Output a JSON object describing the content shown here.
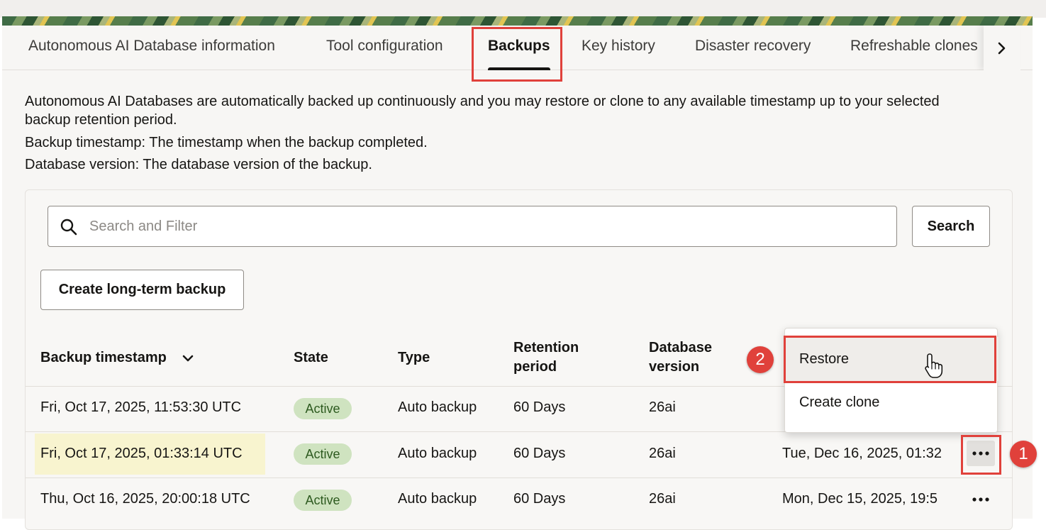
{
  "tabs": [
    {
      "label": "Autonomous AI Database information"
    },
    {
      "label": "Tool configuration"
    },
    {
      "label": "Backups"
    },
    {
      "label": "Key history"
    },
    {
      "label": "Disaster recovery"
    },
    {
      "label": "Refreshable clones"
    }
  ],
  "active_tab": "Backups",
  "description": {
    "line1": "Autonomous AI Databases are automatically backed up continuously and you may restore or clone to any available timestamp up to your selected",
    "line2": "backup retention period.",
    "line3": "Backup timestamp: The timestamp when the backup completed.",
    "line4": "Database version: The database version of the backup."
  },
  "search": {
    "placeholder": "Search and Filter",
    "value": "",
    "button_label": "Search"
  },
  "create_backup_label": "Create long-term backup",
  "table": {
    "headers": {
      "timestamp": "Backup timestamp",
      "state": "State",
      "type": "Type",
      "retention_1": "Retention",
      "retention_2": "period",
      "dbversion_1": "Database",
      "dbversion_2": "version"
    },
    "rows": [
      {
        "timestamp": "Fri, Oct 17, 2025, 11:53:30 UTC",
        "state": "Active",
        "type": "Auto backup",
        "retention": "60 Days",
        "version": "26ai",
        "expires": ""
      },
      {
        "timestamp": "Fri, Oct 17, 2025, 01:33:14 UTC",
        "state": "Active",
        "type": "Auto backup",
        "retention": "60 Days",
        "version": "26ai",
        "expires": "Tue, Dec 16, 2025, 01:32"
      },
      {
        "timestamp": "Thu, Oct 16, 2025, 20:00:18 UTC",
        "state": "Active",
        "type": "Auto backup",
        "retention": "60 Days",
        "version": "26ai",
        "expires": "Mon, Dec 15, 2025, 19:5"
      }
    ]
  },
  "menu": {
    "items": [
      {
        "label": "Restore"
      },
      {
        "label": "Create clone"
      }
    ]
  },
  "markers": {
    "step1": "1",
    "step2": "2"
  },
  "colors": {
    "annotation_red": "#e0413b",
    "active_badge": "#cfe3c0",
    "highlight_row": "#f8f4cf"
  },
  "icons": {
    "search": "search-icon",
    "chevron": "chevron-down-icon",
    "next": "chevron-right-icon",
    "more": "more-actions-icon",
    "cursor": "hand-pointer-icon"
  }
}
